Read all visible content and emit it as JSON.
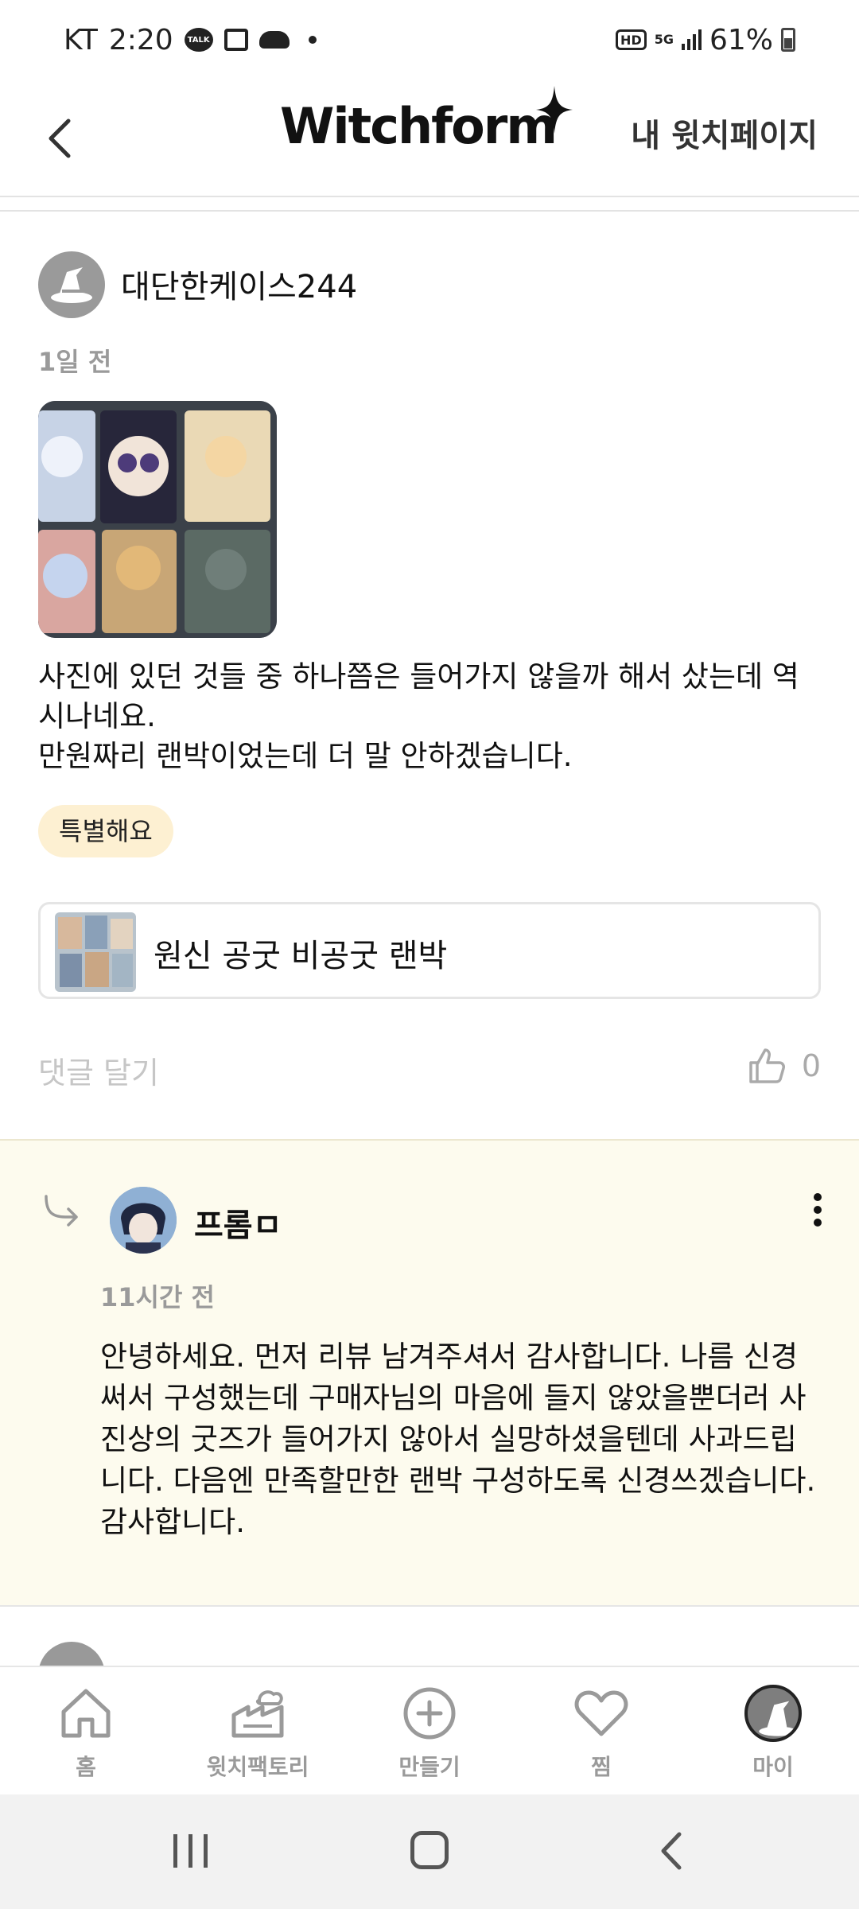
{
  "status_bar": {
    "carrier": "KT",
    "time": "2:20",
    "battery": "61%",
    "network": "5G",
    "hd": "HD",
    "talk_label": "TALK"
  },
  "header": {
    "logo": "Witchform",
    "mypage_label": "내 윗치페이지"
  },
  "review": {
    "username": "대단한케이스244",
    "time": "1일 전",
    "text": "사진에 있던 것들 중 하나쯤은 들어가지 않을까 해서 샀는데 역\n시나네요.\n만원짜리 랜박이었는데 더 말 안하겠습니다.",
    "tag": "특별해요",
    "product_name": "원신 공굿 비공굿 랜박",
    "comment_link": "댓글 달기",
    "like_count": "0"
  },
  "reply": {
    "username": "프롬ㅁ",
    "time": "11시간 전",
    "text": "안녕하세요. 먼저 리뷰 남겨주셔서 감사합니다. 나름 신경\n써서 구성했는데 구매자님의 마음에 들지 않았을뿐더러 사\n진상의 굿즈가 들어가지 않아서 실망하셨을텐데 사과드립\n니다. 다음엔 만족할만한 랜박 구성하도록 신경쓰겠습니다.\n감사합니다."
  },
  "bottom_nav": [
    {
      "label": "홈",
      "icon": "home-icon"
    },
    {
      "label": "윗치팩토리",
      "icon": "factory-icon"
    },
    {
      "label": "만들기",
      "icon": "plus-circle-icon"
    },
    {
      "label": "찜",
      "icon": "heart-icon"
    },
    {
      "label": "마이",
      "icon": "profile-avatar-icon"
    }
  ],
  "colors": {
    "tag_bg": "#fdf0d2",
    "reply_bg": "#fdfbee",
    "muted": "#9a9a9a",
    "text": "#111111"
  }
}
